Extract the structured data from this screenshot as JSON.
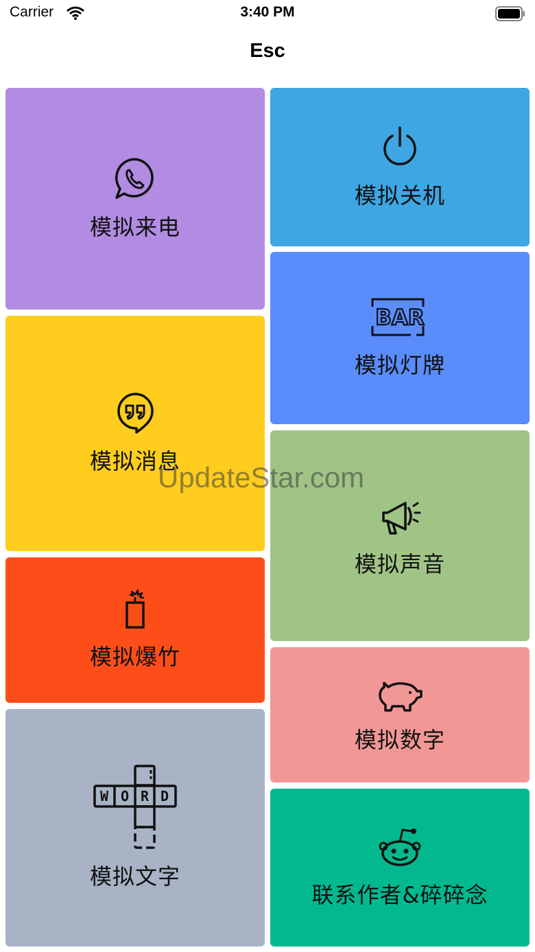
{
  "status_bar": {
    "carrier": "Carrier",
    "time": "3:40 PM"
  },
  "nav": {
    "title": "Esc"
  },
  "tiles": {
    "call": {
      "label": "模拟来电",
      "color": "#b28be2",
      "icon": "whatsapp-phone-icon"
    },
    "shutdown": {
      "label": "模拟关机",
      "color": "#3ea6e2",
      "icon": "power-icon"
    },
    "sign": {
      "label": "模拟灯牌",
      "color": "#5a8cfb",
      "icon": "bar-sign-icon",
      "icon_text": "BAR"
    },
    "message": {
      "label": "模拟消息",
      "color": "#fecd1d",
      "icon": "quote-bubble-icon"
    },
    "sound": {
      "label": "模拟声音",
      "color": "#a0c486",
      "icon": "megaphone-icon"
    },
    "firecracker": {
      "label": "模拟爆竹",
      "color": "#fd4e1a",
      "icon": "firecracker-icon"
    },
    "number": {
      "label": "模拟数字",
      "color": "#f19897",
      "icon": "piggy-icon"
    },
    "text": {
      "label": "模拟文字",
      "color": "#a8b3c5",
      "icon": "crossword-icon",
      "icon_letters": [
        "W",
        "O",
        "R",
        "D"
      ]
    },
    "author": {
      "label": "联系作者&碎碎念",
      "color": "#02b98f",
      "icon": "reddit-alien-icon"
    }
  },
  "watermark": "UpdateStar.com"
}
